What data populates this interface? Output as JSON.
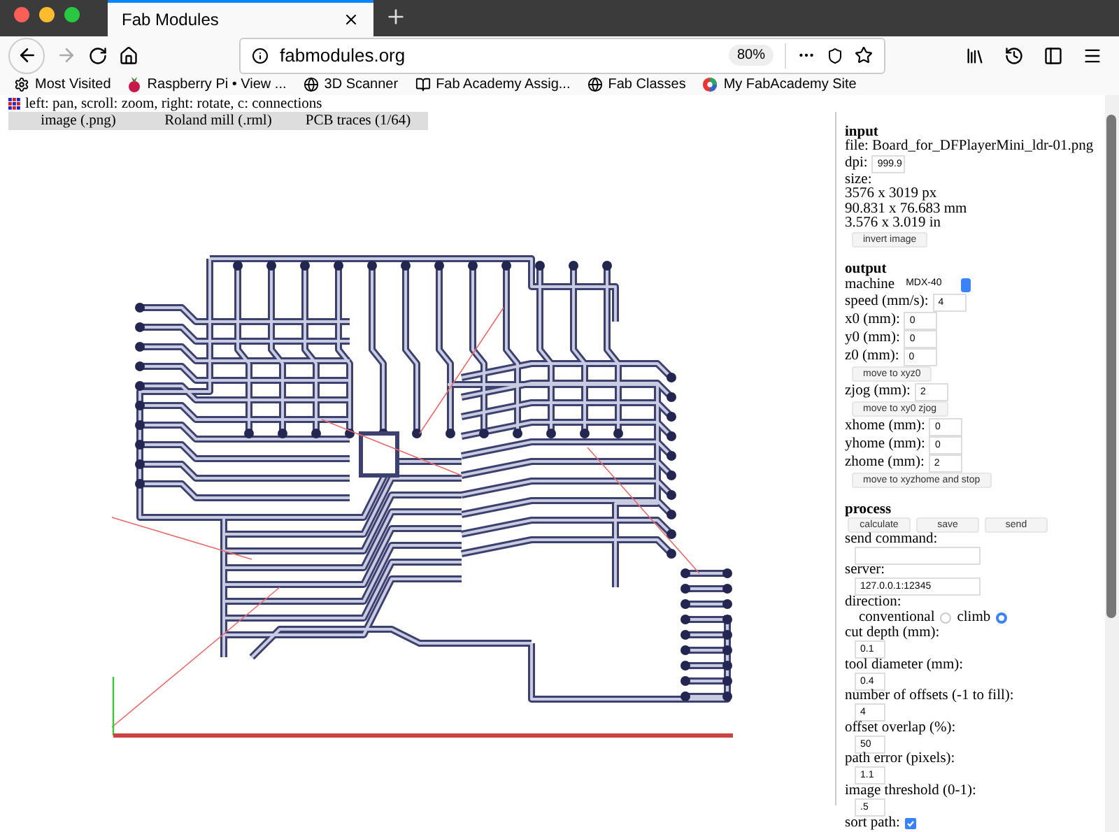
{
  "browser": {
    "tab_title": "Fab Modules",
    "url": "fabmodules.org",
    "zoom": "80%"
  },
  "bookmarks": [
    {
      "label": "Most Visited",
      "kind": "gear"
    },
    {
      "label": "Raspberry Pi • View ...",
      "kind": "berry"
    },
    {
      "label": "3D Scanner",
      "kind": "globe"
    },
    {
      "label": "Fab Academy Assig...",
      "kind": "book"
    },
    {
      "label": "Fab Classes",
      "kind": "globe"
    },
    {
      "label": "My FabAcademy Site",
      "kind": "logo"
    }
  ],
  "hint": "left: pan, scroll: zoom, right: rotate, c: connections",
  "module_tabs": [
    "image (.png)",
    "Roland mill (.rml)",
    "PCB traces (1/64)"
  ],
  "panel": [
    {
      "kind": "heading",
      "text": "input"
    },
    {
      "kind": "text",
      "text": "file: Board_for_DFPlayerMini_ldr-01.png"
    },
    {
      "kind": "field",
      "label": "dpi:",
      "value": "999.9"
    },
    {
      "kind": "text",
      "text": "size:"
    },
    {
      "kind": "text",
      "text": "3576 x 3019 px"
    },
    {
      "kind": "text",
      "text": "90.831 x 76.683 mm"
    },
    {
      "kind": "text",
      "text": "3.576 x 3.019 in"
    },
    {
      "kind": "button",
      "label": "invert image"
    },
    {
      "kind": "heading",
      "text": "output"
    },
    {
      "kind": "select",
      "label": "machine",
      "value": "MDX-40"
    },
    {
      "kind": "field",
      "label": "speed (mm/s):",
      "value": "4"
    },
    {
      "kind": "field",
      "label": "x0 (mm):",
      "value": "0"
    },
    {
      "kind": "field",
      "label": "y0 (mm):",
      "value": "0"
    },
    {
      "kind": "field",
      "label": "z0 (mm):",
      "value": "0"
    },
    {
      "kind": "button",
      "label": "move to xyz0"
    },
    {
      "kind": "field",
      "label": "zjog (mm):",
      "value": "2"
    },
    {
      "kind": "button",
      "label": "move to xy0 zjog"
    },
    {
      "kind": "field",
      "label": "xhome (mm):",
      "value": "0"
    },
    {
      "kind": "field",
      "label": "yhome (mm):",
      "value": "0"
    },
    {
      "kind": "field",
      "label": "zhome (mm):",
      "value": "2"
    },
    {
      "kind": "button",
      "label": "move to xyzhome and stop"
    },
    {
      "kind": "heading",
      "text": "process"
    },
    {
      "kind": "buttons",
      "labels": [
        "calculate",
        "save",
        "send"
      ]
    },
    {
      "kind": "text",
      "text": "send command:"
    },
    {
      "kind": "wide_input"
    },
    {
      "kind": "text",
      "text": "server:"
    },
    {
      "kind": "wide_input",
      "value": "127.0.0.1:12345"
    },
    {
      "kind": "text",
      "text": "direction:"
    },
    {
      "kind": "radios",
      "options": [
        {
          "label": "conventional",
          "selected": false
        },
        {
          "label": "climb",
          "selected": true
        }
      ]
    },
    {
      "kind": "text",
      "text": "cut depth (mm):"
    },
    {
      "kind": "input",
      "value": "0.1"
    },
    {
      "kind": "text",
      "text": "tool diameter (mm):"
    },
    {
      "kind": "input",
      "value": "0.4"
    },
    {
      "kind": "text",
      "text": "number of offsets (-1 to fill):"
    },
    {
      "kind": "input",
      "value": "4"
    },
    {
      "kind": "text",
      "text": "offset overlap (%):"
    },
    {
      "kind": "input",
      "value": "50"
    },
    {
      "kind": "text",
      "text": "path error (pixels):"
    },
    {
      "kind": "input",
      "value": "1.1"
    },
    {
      "kind": "text",
      "text": "image threshold (0-1):"
    },
    {
      "kind": "input",
      "value": ".5"
    },
    {
      "kind": "checkbox",
      "label": "sort path:",
      "checked": true
    }
  ]
}
